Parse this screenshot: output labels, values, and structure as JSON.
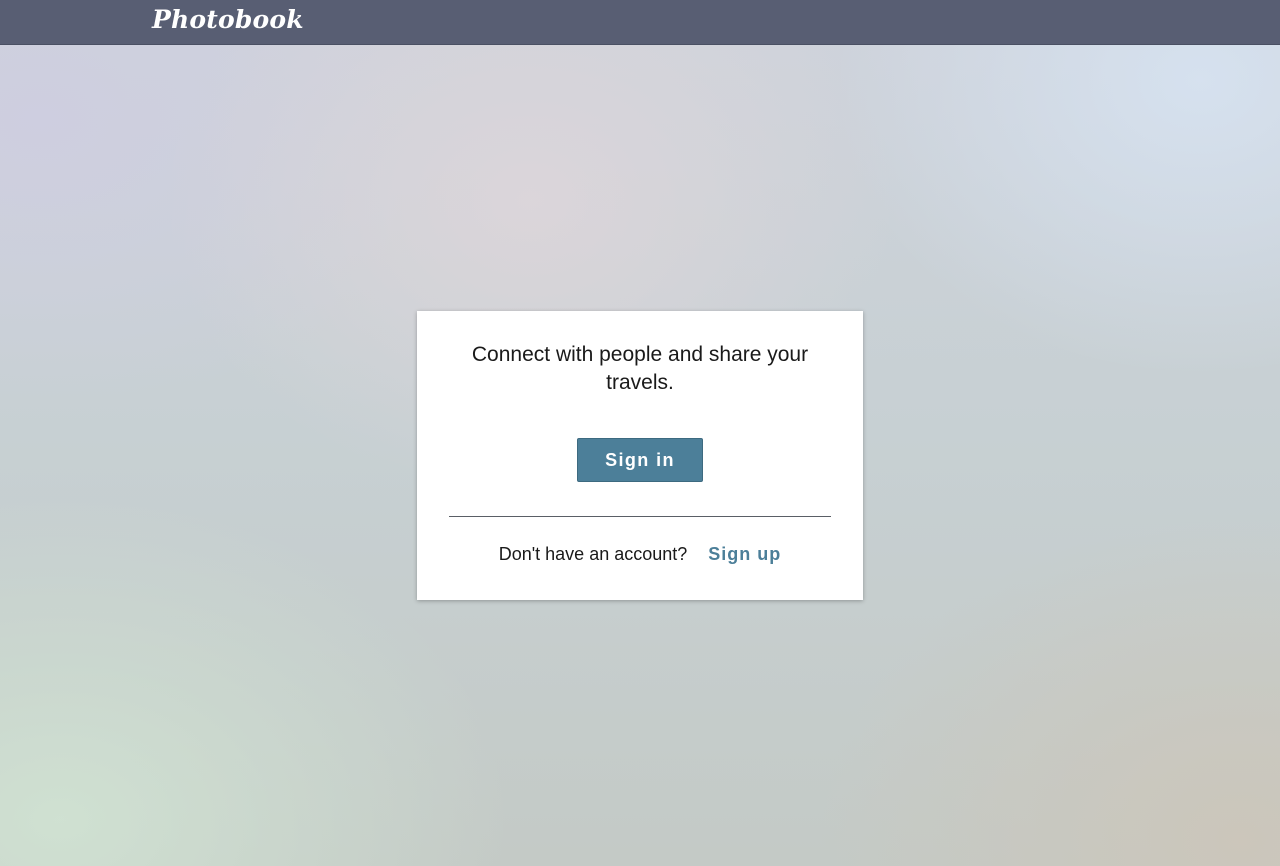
{
  "header": {
    "brand": "Photobook"
  },
  "login_card": {
    "tagline": "Connect with people and share your travels.",
    "sign_in_label": "Sign in",
    "signup_prompt": "Don't have an account?",
    "signup_label": "Sign up"
  },
  "colors": {
    "topbar": "#585e73",
    "accent": "#4c7f99",
    "card_background": "#ffffff"
  }
}
